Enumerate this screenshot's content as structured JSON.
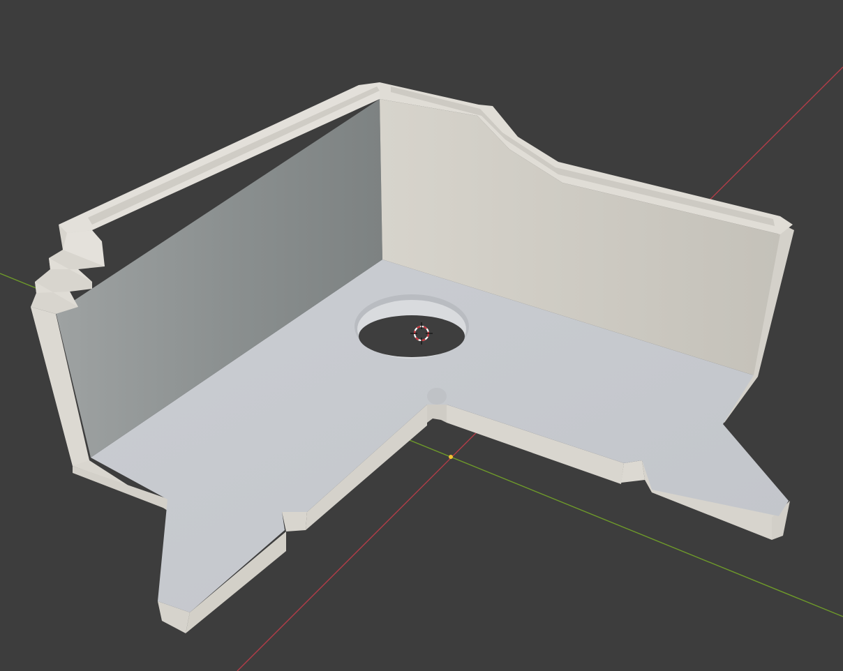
{
  "viewport": {
    "background_color": "#3d3d3d",
    "x_axis_color": "#b33d48",
    "y_axis_color": "#6e9a2a",
    "origin_color": "#f2c230"
  },
  "model": {
    "top_face_color": "#c7c9cc",
    "left_wall_inner_color": "#8c9090",
    "back_wall_inner_color": "#cdcac3",
    "edge_face_color": "#dad7d0",
    "hole_color": "#3e3e3e"
  },
  "cursor": {
    "icon": "3d-cursor-icon",
    "ring_color": "#c8323a",
    "ring_alt_color": "#ffffff"
  }
}
